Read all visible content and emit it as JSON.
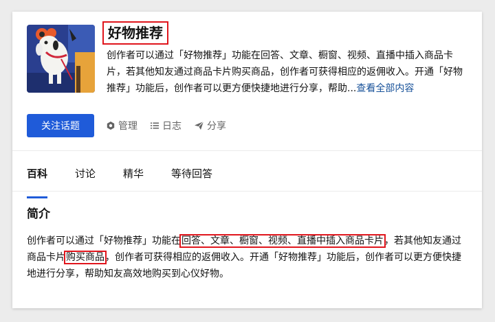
{
  "topic": {
    "title": "好物推荐",
    "description": "创作者可以通过「好物推荐」功能在回答、文章、橱窗、视频、直播中插入商品卡片，若其他知友通过商品卡片购买商品，创作者可获得相应的返佣收入。开通「好物推荐」功能后，创作者可以更方便快捷地进行分享，帮助...",
    "more_label": "查看全部内容"
  },
  "actions": {
    "follow_label": "关注话题",
    "manage_label": "管理",
    "log_label": "日志",
    "share_label": "分享"
  },
  "tabs": [
    {
      "label": "百科"
    },
    {
      "label": "讨论"
    },
    {
      "label": "精华"
    },
    {
      "label": "等待回答"
    }
  ],
  "intro": {
    "heading": "简介",
    "part1": "创作者可以通过「好物推荐」功能在",
    "highlight1": "回答、文章、橱窗、视频、直播中插入商品卡片",
    "part2": "，若其他知友通过商品卡片",
    "highlight2": "购买商品",
    "part3": "，创作者可获得相应的返佣收入。开通「好物推荐」功能后，创作者可以更方便快捷地进行分享，帮助知友高效地购买到心仪好物。"
  },
  "colors": {
    "accent": "#1f5bd9",
    "highlight_box": "#e0141b",
    "link": "#175199"
  }
}
